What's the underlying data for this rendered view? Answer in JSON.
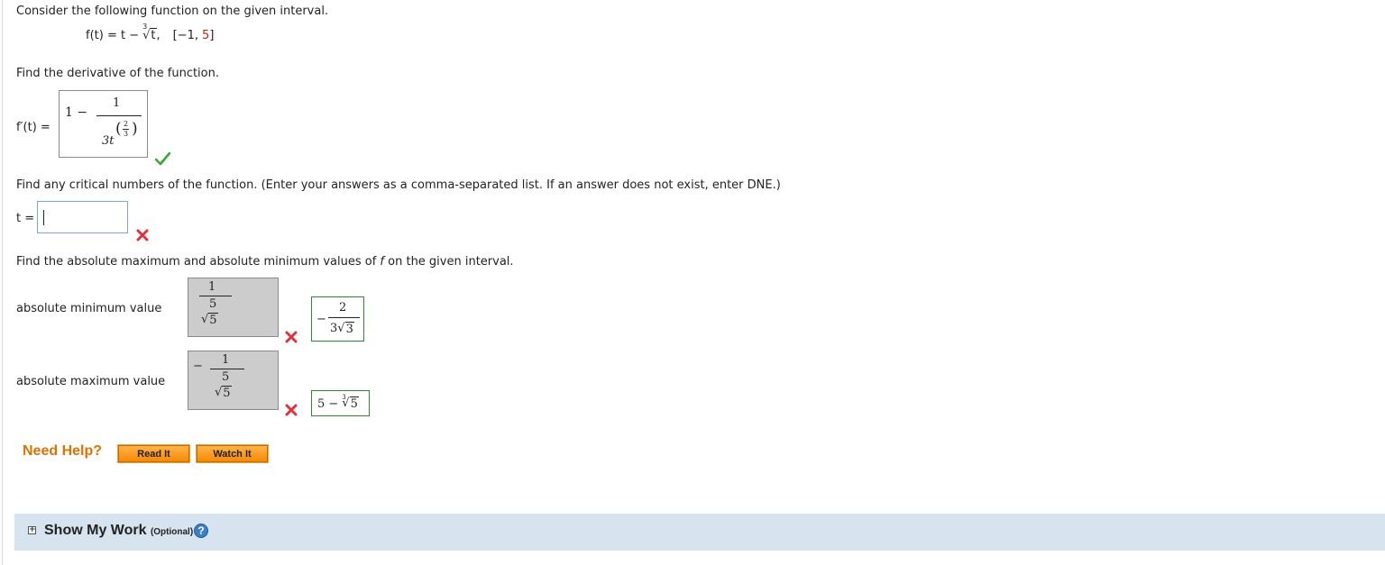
{
  "question": {
    "intro": "Consider the following function on the given interval.",
    "function_lhs": "f(t) = t −",
    "root_index": "3",
    "root_arg": "t",
    "function_sep": ",",
    "interval_open": "[−1,",
    "interval_upper": "5",
    "interval_close": "]"
  },
  "part1": {
    "prompt": "Find the derivative of the function.",
    "label": "f′(t) =",
    "answer_one": "1 −",
    "answer_num": "1",
    "answer_den": "3t",
    "answer_exp_num": "2",
    "answer_exp_den": "3",
    "paren_left": "(",
    "paren_right": ")",
    "status": "correct"
  },
  "part2": {
    "prompt": "Find any critical numbers of the function. (Enter your answers as a comma-separated list. If an answer does not exist, enter DNE.)",
    "label": "t =",
    "value": "",
    "status": "incorrect"
  },
  "part3": {
    "prompt_before": "Find the absolute maximum and absolute minimum values of",
    "prompt_var": "f",
    "prompt_after": "on the given interval.",
    "min_label": "absolute minimum value",
    "min_answer": {
      "num": "1",
      "mid": "5",
      "root": "5"
    },
    "min_correct": {
      "minus": "−",
      "num": "2",
      "den_coef": "3",
      "den_root": "3"
    },
    "max_label": "absolute maximum value",
    "max_answer": {
      "minus": "−",
      "num": "1",
      "mid": "5",
      "root": "5"
    },
    "max_correct": {
      "lead": "5 −",
      "root_index": "3",
      "root_arg": "5"
    }
  },
  "help": {
    "title": "Need Help?",
    "read_label": "Read It",
    "watch_label": "Watch It"
  },
  "show_work": {
    "expander_symbol": "+",
    "label": "Show My Work",
    "optional": "(Optional)",
    "help_symbol": "?"
  },
  "colors": {
    "interval_accent": "#cc2200",
    "help_title": "#e07000",
    "button": "#f58a07",
    "correct": "#2e8b2e",
    "incorrect": "#e0303a",
    "show_work_bg": "#d7e3ee"
  }
}
